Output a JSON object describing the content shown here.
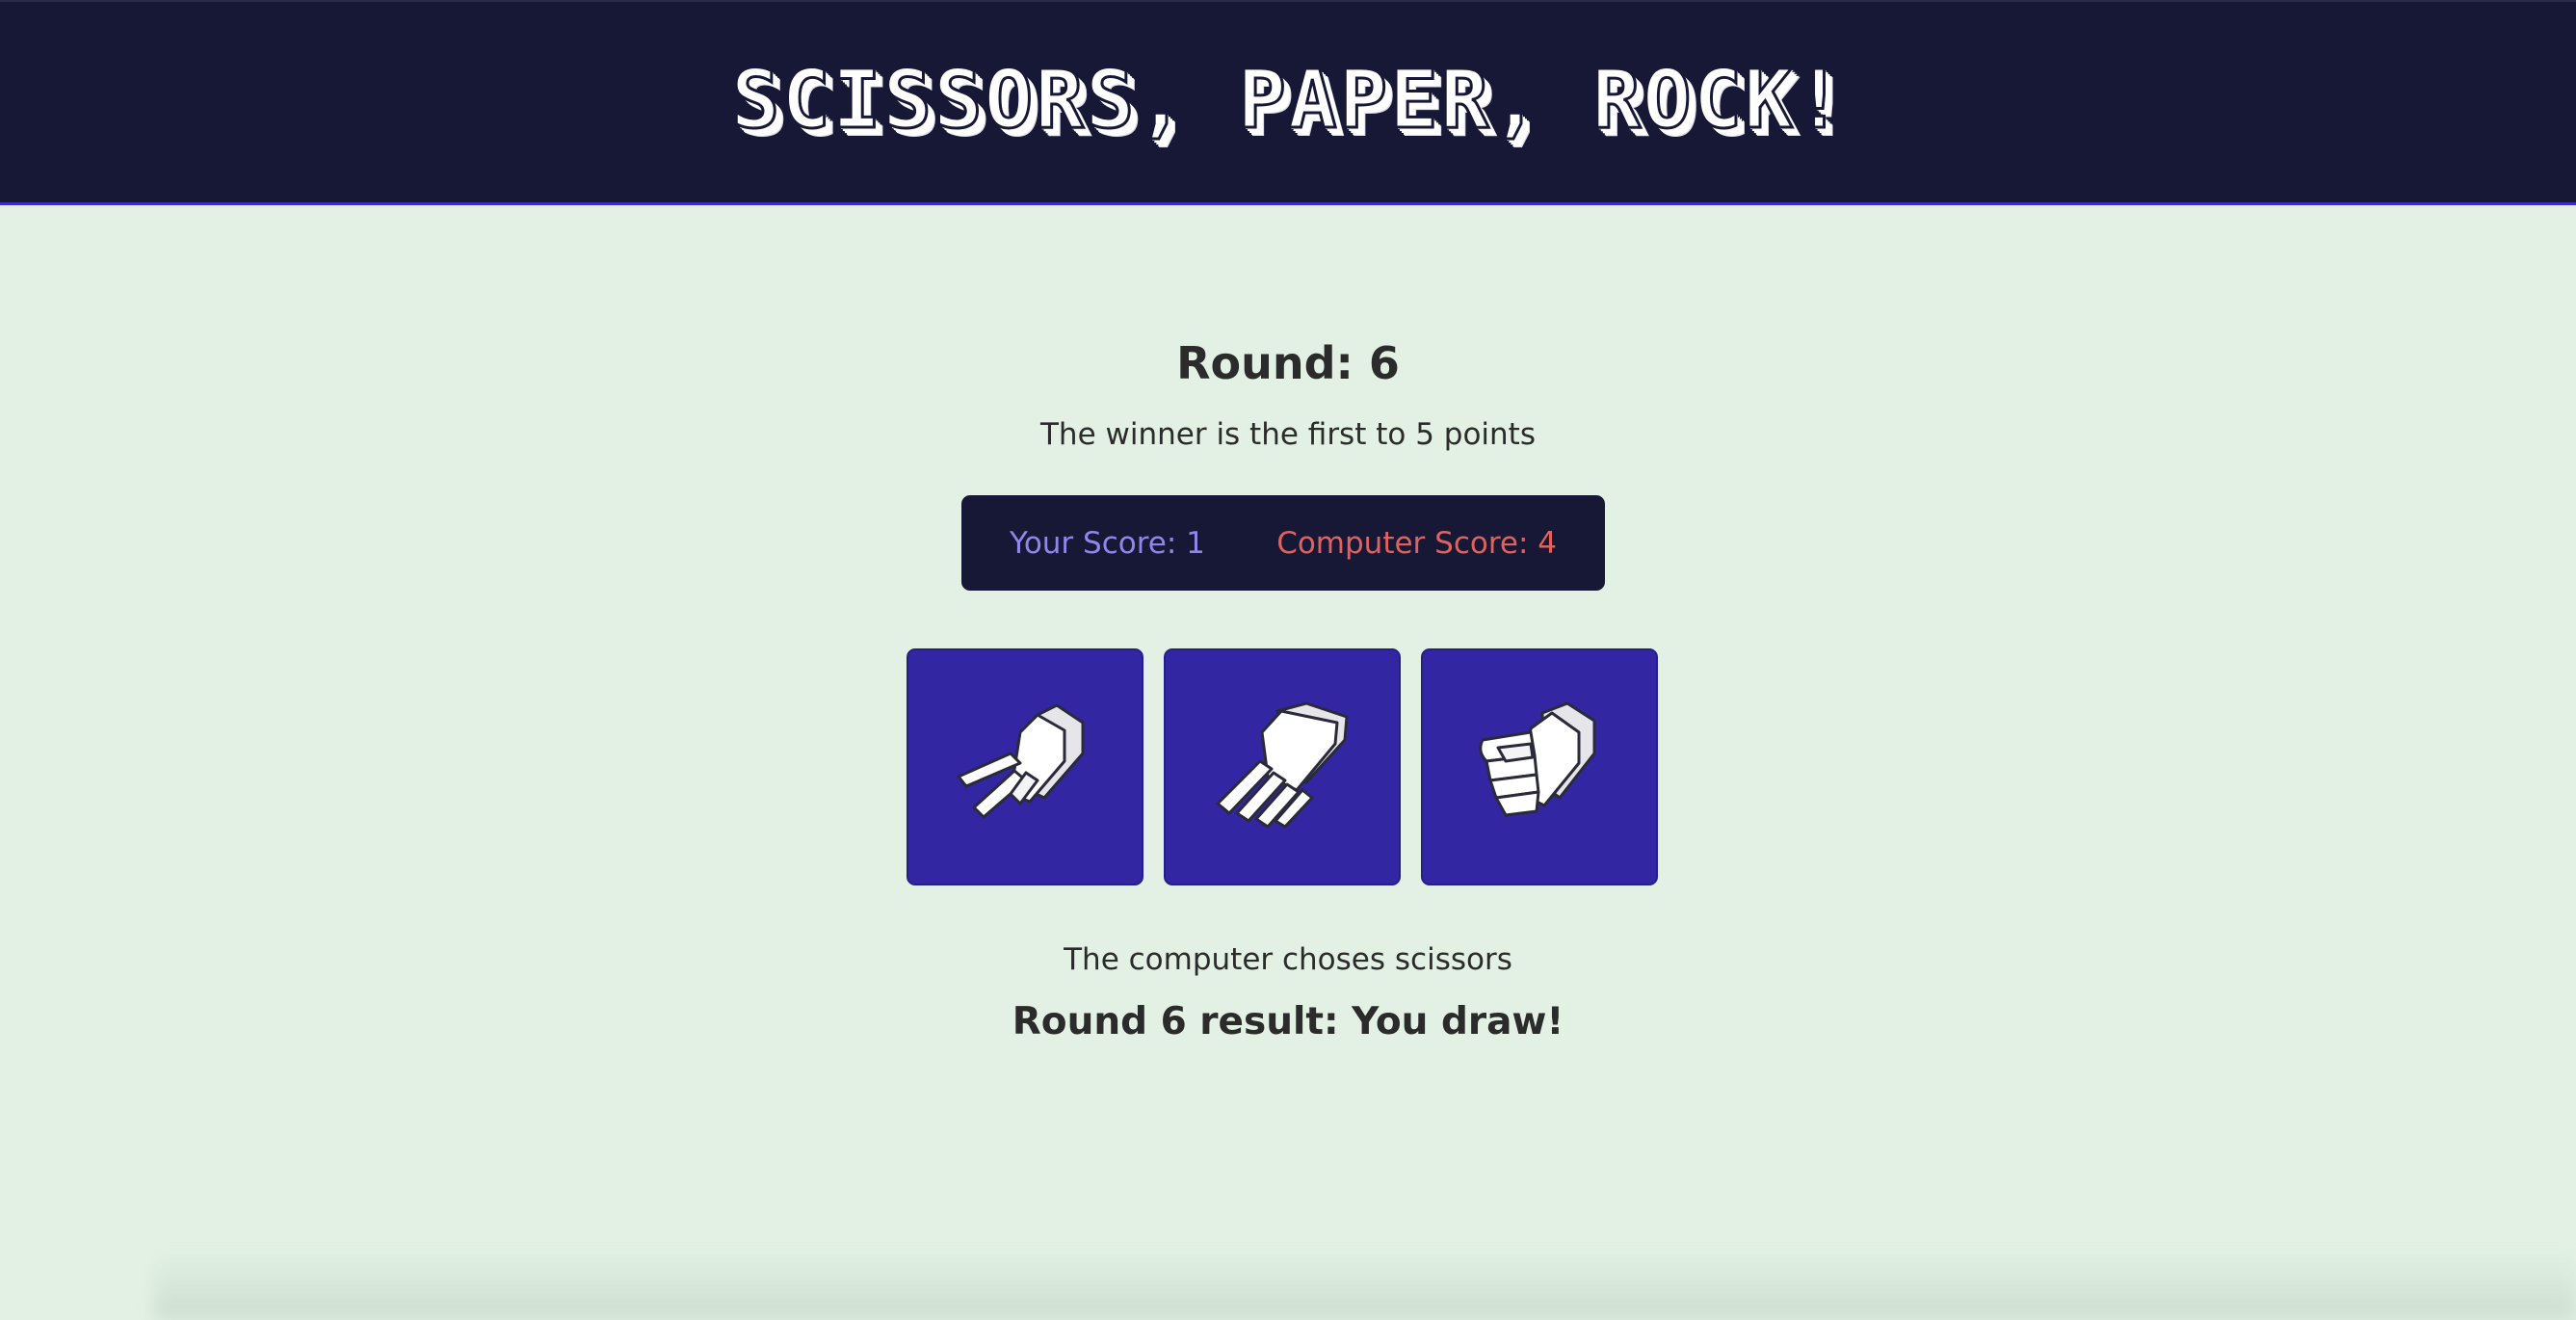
{
  "header": {
    "title": "SCISSORS, PAPER, ROCK!"
  },
  "game": {
    "round_label": "Round: 6",
    "rule_text": "The winner is the first to 5 points",
    "scores": {
      "player": "Your Score: 1",
      "computer": "Computer Score: 4"
    },
    "choices": [
      {
        "name": "scissors",
        "icon": "scissors-hand-icon"
      },
      {
        "name": "paper",
        "icon": "paper-hand-icon"
      },
      {
        "name": "rock",
        "icon": "rock-fist-icon"
      }
    ],
    "computer_choice_text": "The computer choses scissors",
    "result_text": "Round 6 result: You draw!"
  },
  "colors": {
    "background": "#e2f1e4",
    "header": "#171836",
    "button": "#3226a3",
    "player_score": "#8f86ea",
    "computer_score": "#e0625f"
  }
}
